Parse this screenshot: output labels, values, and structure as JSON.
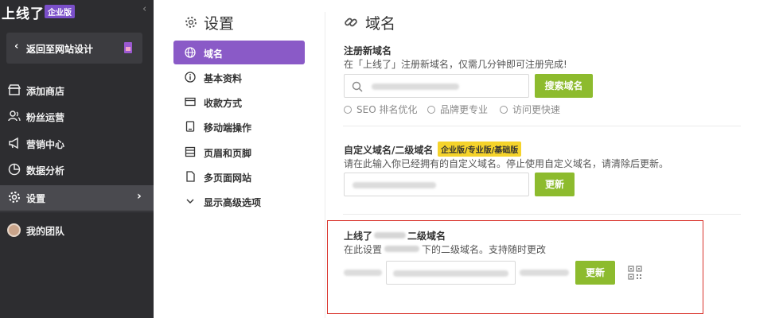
{
  "sidebar": {
    "brand": "上线了",
    "brand_badge": "企业版",
    "collapse_glyph": "‹",
    "back_label": "返回至网站设计",
    "items": [
      {
        "label": "添加商店",
        "icon": "store-icon"
      },
      {
        "label": "粉丝运营",
        "icon": "users-icon"
      },
      {
        "label": "营销中心",
        "icon": "megaphone-icon"
      },
      {
        "label": "数据分析",
        "icon": "pie-chart-icon"
      },
      {
        "label": "设置",
        "icon": "gear-icon",
        "active": true
      },
      {
        "label": "我的团队",
        "icon": "avatar"
      }
    ]
  },
  "settings": {
    "title": "设置",
    "items": [
      {
        "label": "域名",
        "icon": "globe-icon",
        "active": true
      },
      {
        "label": "基本资料",
        "icon": "info-icon"
      },
      {
        "label": "收款方式",
        "icon": "card-icon"
      },
      {
        "label": "移动端操作",
        "icon": "mobile-icon"
      },
      {
        "label": "页眉和页脚",
        "icon": "layout-icon"
      },
      {
        "label": "多页面网站",
        "icon": "pages-icon"
      },
      {
        "label": "显示高级选项",
        "icon": "chevron-down-icon"
      }
    ]
  },
  "main": {
    "title": "域名",
    "register": {
      "title": "注册新域名",
      "desc": "在「上线了」注册新域名，仅需几分钟即可注册完成!",
      "button": "搜索域名",
      "features": [
        "SEO 排名优化",
        "品牌更专业",
        "访问更快速"
      ]
    },
    "custom": {
      "title": "自定义域名/二级域名",
      "tag": "企业版/专业版/基础版",
      "desc": "请在此输入你已经拥有的自定义域名。停止使用自定义域名，请清除后更新。",
      "button": "更新"
    },
    "subdomain": {
      "title_prefix": "上线了",
      "title_suffix": "二级域名",
      "desc_prefix": "在此设置",
      "desc_suffix": "下的二级域名。支持随时更改",
      "button": "更新"
    }
  },
  "colors": {
    "sidebar_bg": "#2d2d30",
    "accent_purple": "#8a5ac7",
    "button_green": "#8dbb2e",
    "tag_yellow": "#f5d32b",
    "highlight_red": "#d9322b"
  }
}
